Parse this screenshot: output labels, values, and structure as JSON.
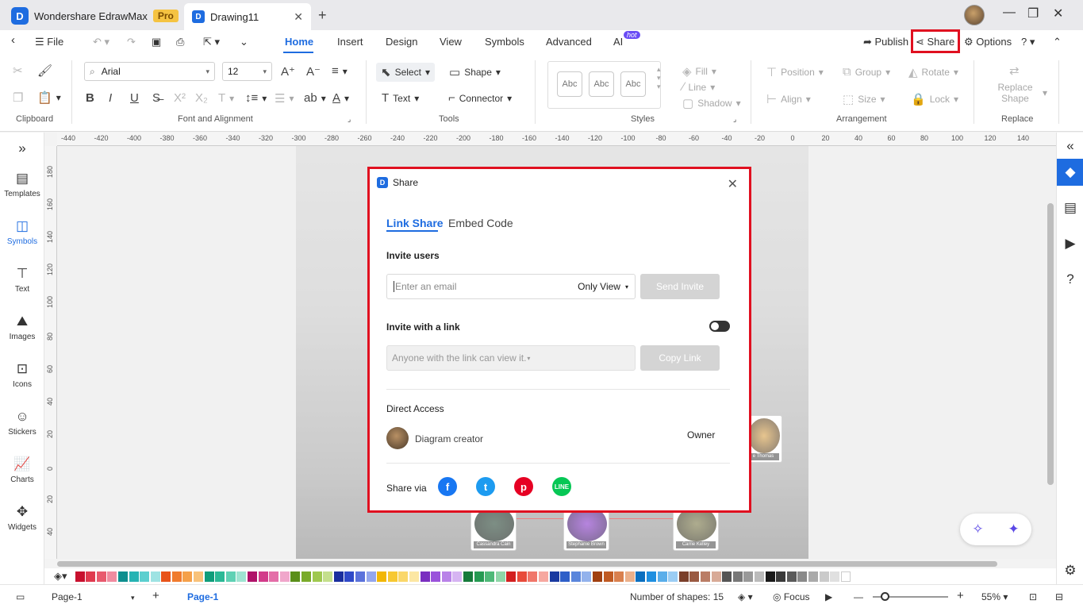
{
  "app": {
    "name": "Wondershare EdrawMax",
    "badge": "Pro",
    "doc_tab": "Drawing11"
  },
  "menubar": {
    "file": "File",
    "tabs": [
      "Home",
      "Insert",
      "Design",
      "View",
      "Symbols",
      "Advanced",
      "AI"
    ],
    "ai_badge": "hot",
    "publish": "Publish",
    "share": "Share",
    "options": "Options"
  },
  "ribbon": {
    "font": "Arial",
    "size": "12",
    "select": "Select",
    "shape": "Shape",
    "text": "Text",
    "connector": "Connector",
    "style_sample": "Abc",
    "fill": "Fill",
    "line": "Line",
    "shadow": "Shadow",
    "position": "Position",
    "group": "Group",
    "rotate": "Rotate",
    "align": "Align",
    "size_label": "Size",
    "lock": "Lock",
    "replace_shape": "Replace Shape",
    "groups": [
      "Clipboard",
      "Font and Alignment",
      "Tools",
      "Styles",
      "Arrangement",
      "Replace"
    ]
  },
  "ruler": {
    "h": [
      "-440",
      "-420",
      "-400",
      "-380",
      "-360",
      "-340",
      "-320",
      "-300",
      "-280",
      "-260",
      "-240",
      "-220",
      "-200",
      "-180",
      "-160",
      "-140",
      "-120",
      "-100",
      "-80",
      "-60",
      "-40",
      "-20",
      "0",
      "20",
      "40",
      "60",
      "80",
      "100",
      "120",
      "140"
    ],
    "v": [
      "180",
      "160",
      "140",
      "120",
      "100",
      "80",
      "60",
      "40",
      "20",
      "0",
      "20",
      "40"
    ]
  },
  "left_panel": [
    "Templates",
    "Symbols",
    "Text",
    "Images",
    "Icons",
    "Stickers",
    "Charts",
    "Widgets"
  ],
  "canvas": {
    "nodes": [
      "Cassandra Cain",
      "Stephanie Brown",
      "Carrie Kelley",
      "e Thomas"
    ]
  },
  "share_dialog": {
    "title": "Share",
    "tabs": [
      "Link Share",
      "Embed Code"
    ],
    "invite_users": "Invite users",
    "email_placeholder": "Enter an email",
    "permission": "Only View",
    "send_invite": "Send Invite",
    "invite_link": "Invite with a link",
    "link_permission": "Anyone with the link can view it.",
    "copy_link": "Copy Link",
    "direct_access": "Direct Access",
    "creator": "Diagram creator",
    "owner": "Owner",
    "share_via": "Share via",
    "socials": [
      "facebook-icon",
      "twitter-icon",
      "pinterest-icon",
      "line-icon"
    ]
  },
  "status": {
    "page_select": "Page-1",
    "page_tab": "Page-1",
    "shapes": "Number of shapes: 15",
    "focus": "Focus",
    "zoom": "55%"
  },
  "colors": {
    "accent": "#1e6ce0",
    "highlight": "#e01020",
    "palette": [
      "#c8102e",
      "#e03a4f",
      "#e85a6e",
      "#f08ca0",
      "#0e8f8f",
      "#26b3b3",
      "#5ccfcf",
      "#9ee3e3",
      "#e8541a",
      "#f07b2e",
      "#f5a04a",
      "#f8c27a",
      "#0f9d7a",
      "#2bb996",
      "#5fd1b4",
      "#9fe4d2",
      "#b0126a",
      "#d23b8a",
      "#e46ea8",
      "#f0a6cb",
      "#5a8f1a",
      "#7aab2a",
      "#9fc84f",
      "#c4df8c",
      "#1a2e9e",
      "#2f49c8",
      "#5b72db",
      "#94a6ec",
      "#f2b705",
      "#f7c832",
      "#fad76a",
      "#fce7a3",
      "#7a2fc0",
      "#9a52db",
      "#b982e8",
      "#d6b4f2",
      "#167a3a",
      "#259a52",
      "#4fb978",
      "#8fd6a8",
      "#d32020",
      "#e84b3b",
      "#f0766a",
      "#f6a8a0",
      "#1a3aa0",
      "#2e5fc8",
      "#5a86dc",
      "#93b2ec",
      "#a04010",
      "#c05a22",
      "#d9804e",
      "#ebb08a",
      "#0a6fc0",
      "#1f8fe0",
      "#5aaeea",
      "#9bcdf4",
      "#7a3f2a",
      "#9a5a42",
      "#ba7d66",
      "#d8aa97",
      "#555555",
      "#777777",
      "#999999",
      "#bbbbbb",
      "#1a1a1a",
      "#3a3a3a",
      "#5a5a5a",
      "#8a8a8a",
      "#aaaaaa",
      "#cacaca",
      "#e0e0e0",
      "#ffffff"
    ]
  }
}
